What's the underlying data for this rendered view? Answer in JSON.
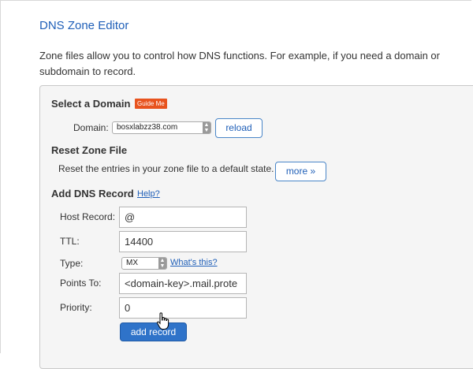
{
  "page": {
    "title": "DNS Zone Editor",
    "intro": "Zone files allow you to control how DNS functions. For example, if you need a domain or subdomain to record."
  },
  "select_domain": {
    "heading": "Select a Domain",
    "guide_badge": "Guide Me",
    "domain_label": "Domain:",
    "domain_value": "bosxlabzz38.com",
    "reload_label": "reload"
  },
  "reset_zone": {
    "heading": "Reset Zone File",
    "description": "Reset the entries in your zone file to a default state.",
    "more_label": "more »"
  },
  "add_record": {
    "heading": "Add DNS Record",
    "help_link": "Help?",
    "host_label": "Host Record:",
    "host_value": "@",
    "ttl_label": "TTL:",
    "ttl_value": "14400",
    "type_label": "Type:",
    "type_value": "MX",
    "whats_this": "What's this?",
    "points_label": "Points To:",
    "points_value": "<domain-key>.mail.prote",
    "priority_label": "Priority:",
    "priority_value": "0",
    "submit_label": "add record"
  },
  "colors": {
    "accent": "#1f5fb8",
    "badge": "#e8531e",
    "primary_button": "#2f73c9"
  },
  "icons": {
    "cursor": "hand-pointer-icon",
    "select_arrows": "updown-arrows-icon"
  }
}
